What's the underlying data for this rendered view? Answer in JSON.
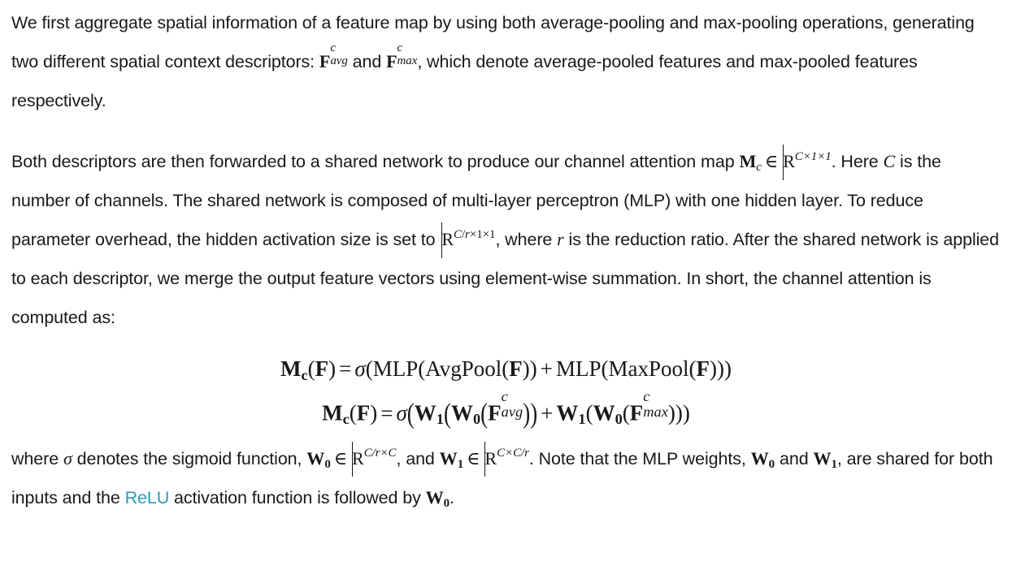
{
  "document": {
    "title": "CBAM channel attention description",
    "background_color": "#ffffff",
    "text_color": "#18191b",
    "link_color": "#2c9bbd"
  },
  "paragraphs": {
    "p1": {
      "t1": "We first aggregate spatial information of a feature map by using both average-pooling and max-pooling operations, generating two different spatial context descriptors: ",
      "m1_base": "F",
      "m1_sup": "c",
      "m1_sub": "avg",
      "t2": " and ",
      "m2_base": "F",
      "m2_sup": "c",
      "m2_sub": "max",
      "t3": ", which denote average-pooled features and max-pooled features respectively."
    },
    "p2": {
      "t1": "Both descriptors are then forwarded to a shared network to produce our channel attention map ",
      "m1_base": "M",
      "m1_sub": "c",
      "m1_in": "∈",
      "m1_set": "R",
      "m1_exp": "C×1×1",
      "t2": ". Here ",
      "m2": "C",
      "t3": " is the number of channels. The shared network is composed of multi-layer perceptron (MLP) with one hidden layer. To reduce parameter overhead, the hidden activation size is set to ",
      "m3_set": "R",
      "m3_exp_num": "C",
      "m3_exp_slash": "/",
      "m3_exp_den": "r",
      "m3_exp_rest": "×1×1",
      "t4": ", where ",
      "m4": "r",
      "t5": " is the reduction ratio. After the shared network is applied to each descriptor, we merge the output feature vectors using element-wise summation. In short, the channel attention is computed as:"
    },
    "p3": {
      "t1": "where ",
      "sigma": "σ",
      "t2": " denotes the sigmoid function, ",
      "m1_base": "W",
      "m1_sub": "0",
      "m1_in": "∈",
      "m1_set": "R",
      "m1_exp": "C/r×C",
      "t3": ", and ",
      "m2_base": "W",
      "m2_sub": "1",
      "m2_in": "∈",
      "m2_set": "R",
      "m2_exp": "C×C/r",
      "t4": ". Note that the MLP weights, ",
      "m3_base": "W",
      "m3_sub": "0",
      "t5": " and ",
      "m4_base": "W",
      "m4_sub": "1",
      "t6": ", are shared for both inputs and the ",
      "link": "ReLU",
      "t7": " activation function is followed by ",
      "m5_base": "W",
      "m5_sub": "0",
      "t8": "."
    }
  },
  "equations": {
    "eq1": {
      "lhs_base": "M",
      "lhs_sub": "c",
      "lhs_arg_open": "(",
      "lhs_arg": "F",
      "lhs_arg_close": ")",
      "equals": "=",
      "sigma": "σ",
      "open": "(",
      "mlp1": "MLP",
      "avgpool": "AvgPool",
      "arg": "F",
      "plus": "+",
      "mlp2": "MLP",
      "maxpool": "MaxPool",
      "full_text": "M_c(F) = σ(MLP(AvgPool(F)) + MLP(MaxPool(F)))"
    },
    "eq2": {
      "lhs_base": "M",
      "lhs_sub": "c",
      "lhs_arg": "F",
      "equals": "=",
      "sigma": "σ",
      "w1": "W",
      "w1_sub": "1",
      "w0": "W",
      "w0_sub": "0",
      "f": "F",
      "f_sup": "c",
      "f_sub_avg": "avg",
      "f_sub_max": "max",
      "plus": "+",
      "full_text": "M_c(F) = σ(W_1(W_0(F^c_avg)) + W_1(W_0(F^c_max)))"
    }
  }
}
